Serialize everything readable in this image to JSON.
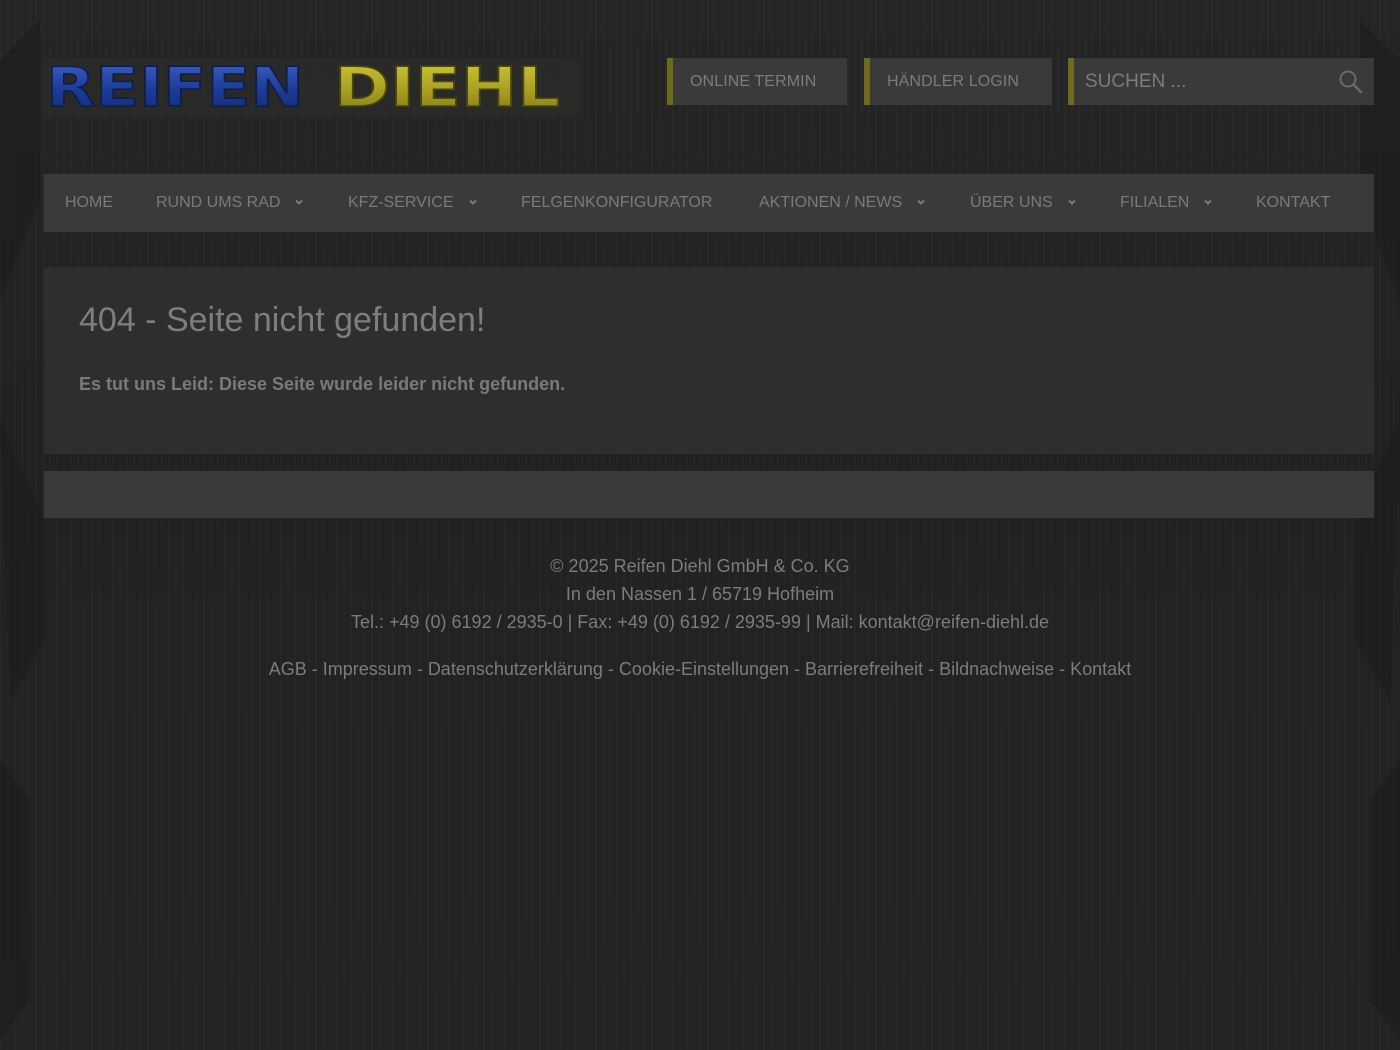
{
  "header": {
    "logo_text_blue": "REIFEN",
    "logo_text_yellow": "DIEHL",
    "online_termin_label": "ONLINE TERMIN",
    "haendler_login_label": "HÄNDLER LOGIN",
    "search": {
      "placeholder": "SUCHEN ..."
    }
  },
  "nav": {
    "items": [
      {
        "label": "HOME",
        "has_dropdown": false
      },
      {
        "label": "RUND UMS RAD",
        "has_dropdown": true
      },
      {
        "label": "KFZ-SERVICE",
        "has_dropdown": true
      },
      {
        "label": "FELGENKONFIGURATOR",
        "has_dropdown": false
      },
      {
        "label": "AKTIONEN / NEWS",
        "has_dropdown": true
      },
      {
        "label": "ÜBER UNS",
        "has_dropdown": true
      },
      {
        "label": "FILIALEN",
        "has_dropdown": true
      },
      {
        "label": "KONTAKT",
        "has_dropdown": false
      }
    ]
  },
  "main": {
    "title": "404 - Seite nicht gefunden!",
    "message": "Es tut uns Leid: Diese Seite wurde leider nicht gefunden."
  },
  "footer": {
    "copyright": "© 2025 Reifen Diehl GmbH & Co. KG",
    "address": "In den Nassen 1 / 65719 Hofheim",
    "contact": "Tel.: +49 (0) 6192 / 2935-0 | Fax: +49 (0) 6192 / 2935-99 | Mail: kontakt@reifen-diehl.de",
    "links": [
      "AGB",
      "Impressum",
      "Datenschutzerklärung",
      "Cookie-Einstellungen",
      "Barrierefreiheit",
      "Bildnachweise",
      "Kontakt"
    ],
    "link_separator": " - "
  },
  "colors": {
    "accent": "#6e6a1a",
    "background": "#232323",
    "panel": "#3a3a3a",
    "logo_blue": "#1d3f9e",
    "logo_yellow": "#b7ae2a"
  }
}
